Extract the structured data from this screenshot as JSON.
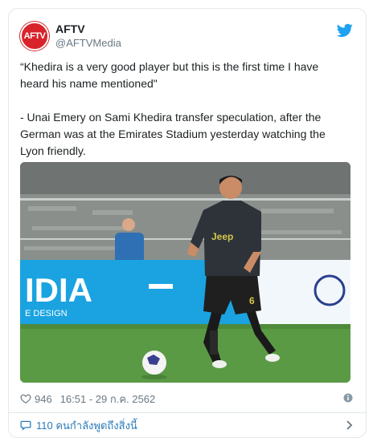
{
  "tweet": {
    "avatar_text": "AFTV",
    "display_name": "AFTV",
    "handle": "@AFTVMedia",
    "text_lines": [
      "“Khedira is a very good player but this is the first time I have",
      "heard his name mentioned\"",
      "- Unai Emery on Sami Khedira transfer speculation, after the",
      "German was at the Emirates Stadium yesterday watching the",
      "Lyon friendly."
    ],
    "likes": "946",
    "timestamp": "16:51 - 29 ก.ค. 2562",
    "replies_label": "110 คนกำลังพูดถึงสิ่งนี้"
  },
  "media": {
    "ad_board_text": "IDIA",
    "ad_board_subtext": "E DESIGN",
    "shirt_text": "Jeep",
    "shirt_number": "6"
  },
  "colors": {
    "accent": "#2b7bb9",
    "twitter_blue": "#1da1f2",
    "brand_red": "#d8232a",
    "muted": "#697882"
  },
  "icons": {
    "brand": "twitter-bird-icon",
    "like": "heart-icon",
    "info": "info-icon",
    "reply": "speech-bubble-icon",
    "more": "chevron-right-icon"
  }
}
